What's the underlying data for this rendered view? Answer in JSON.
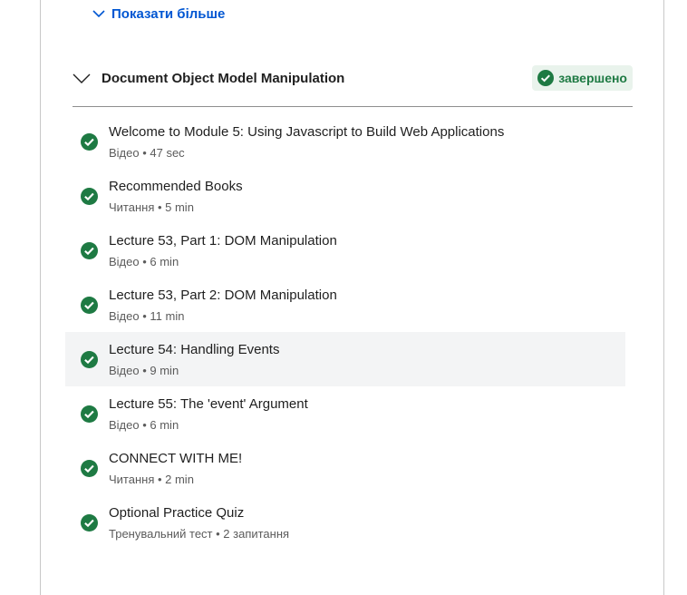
{
  "show_more": {
    "label": "Показати більше"
  },
  "module": {
    "title": "Document Object Model Manipulation",
    "status": "завершено"
  },
  "colors": {
    "link": "#0056d2",
    "complete_green": "#1e7a43",
    "badge_bg": "#e9f3ec",
    "highlight_bg": "#f3f4f5"
  },
  "items": [
    {
      "title": "Welcome to Module 5: Using Javascript to Build Web Applications",
      "meta": "Відео • 47 sec",
      "icon": "check-circle-icon"
    },
    {
      "title": "Recommended Books",
      "meta": "Читання • 5 min",
      "icon": "check-circle-icon"
    },
    {
      "title": "Lecture 53, Part 1: DOM Manipulation",
      "meta": "Відео • 6 min",
      "icon": "check-circle-icon"
    },
    {
      "title": "Lecture 53, Part 2: DOM Manipulation",
      "meta": "Відео • 11 min",
      "icon": "check-circle-icon"
    },
    {
      "title": "Lecture 54: Handling Events",
      "meta": "Відео • 9 min",
      "icon": "check-circle-icon"
    },
    {
      "title": "Lecture 55: The 'event' Argument",
      "meta": "Відео • 6 min",
      "icon": "check-circle-icon"
    },
    {
      "title": "CONNECT WITH ME!",
      "meta": "Читання • 2 min",
      "icon": "check-circle-icon"
    },
    {
      "title": "Optional Practice Quiz",
      "meta": "Тренувальний тест • 2 запитання",
      "icon": "check-circle-icon"
    }
  ]
}
